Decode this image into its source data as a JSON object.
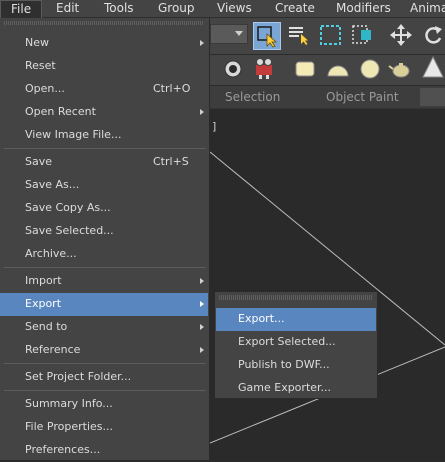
{
  "menubar": {
    "items": [
      "File",
      "Edit",
      "Tools",
      "Group",
      "Views",
      "Create",
      "Modifiers",
      "Animat"
    ]
  },
  "ribbon": {
    "tabs": [
      "Selection",
      "Object Paint"
    ]
  },
  "viewport": {
    "label": "]"
  },
  "file_menu": {
    "items": [
      {
        "label": "New",
        "shortcut": "",
        "submenu": true
      },
      {
        "label": "Reset",
        "shortcut": "",
        "submenu": false
      },
      {
        "label": "Open...",
        "shortcut": "Ctrl+O",
        "submenu": false
      },
      {
        "label": "Open Recent",
        "shortcut": "",
        "submenu": true
      },
      {
        "label": "View Image File...",
        "shortcut": "",
        "submenu": false
      },
      {
        "label": "Save",
        "shortcut": "Ctrl+S",
        "submenu": false
      },
      {
        "label": "Save As...",
        "shortcut": "",
        "submenu": false
      },
      {
        "label": "Save Copy As...",
        "shortcut": "",
        "submenu": false
      },
      {
        "label": "Save Selected...",
        "shortcut": "",
        "submenu": false
      },
      {
        "label": "Archive...",
        "shortcut": "",
        "submenu": false
      },
      {
        "label": "Import",
        "shortcut": "",
        "submenu": true
      },
      {
        "label": "Export",
        "shortcut": "",
        "submenu": true,
        "highlighted": true
      },
      {
        "label": "Send to",
        "shortcut": "",
        "submenu": true
      },
      {
        "label": "Reference",
        "shortcut": "",
        "submenu": true
      },
      {
        "label": "Set Project Folder...",
        "shortcut": "",
        "submenu": false
      },
      {
        "label": "Summary Info...",
        "shortcut": "",
        "submenu": false
      },
      {
        "label": "File Properties...",
        "shortcut": "",
        "submenu": false
      },
      {
        "label": "Preferences...",
        "shortcut": "",
        "submenu": false
      }
    ]
  },
  "export_submenu": {
    "items": [
      {
        "label": "Export...",
        "highlighted": true
      },
      {
        "label": "Export Selected..."
      },
      {
        "label": "Publish to DWF..."
      },
      {
        "label": "Game Exporter..."
      }
    ]
  },
  "colors": {
    "menu_bg": "#444444",
    "highlight": "#5a86c0",
    "viewport_bg": "#2a2a2a"
  }
}
